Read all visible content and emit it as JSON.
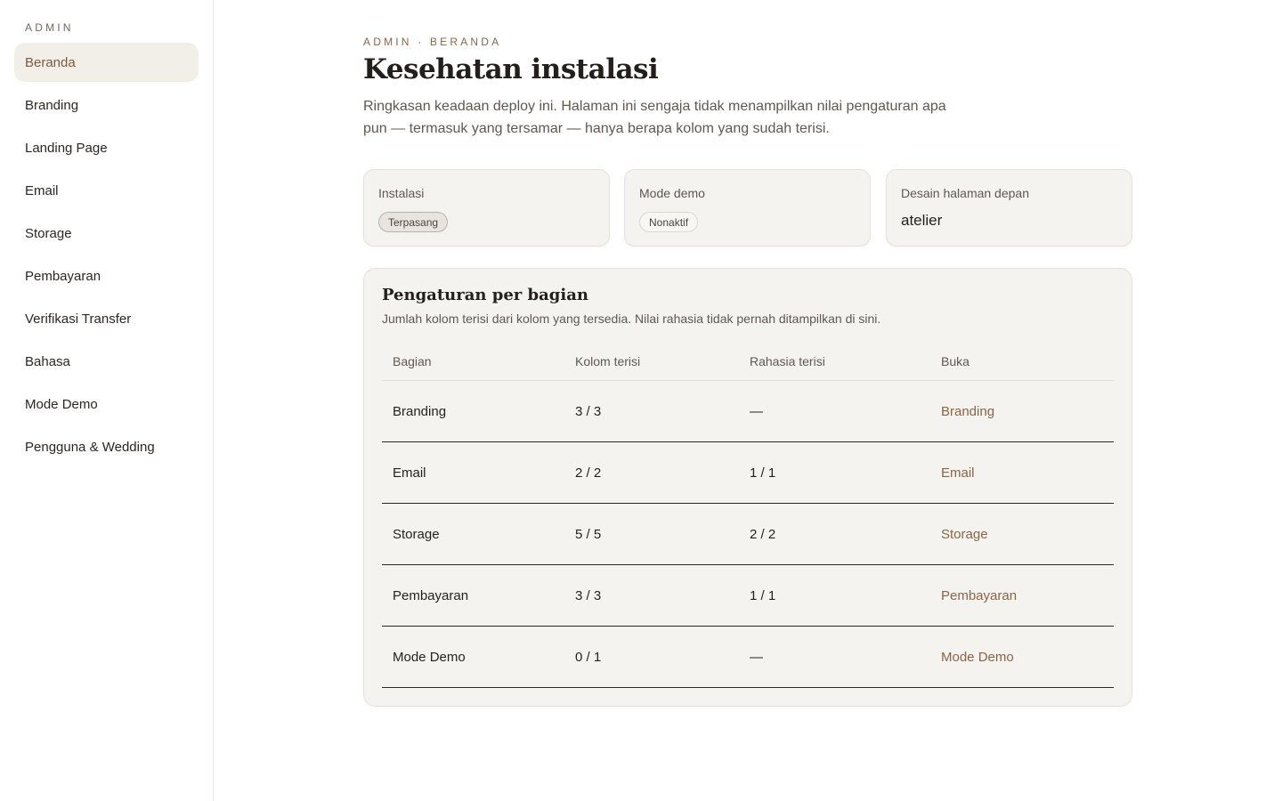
{
  "sidebar": {
    "heading": "ADMIN",
    "items": [
      {
        "label": "Beranda",
        "active": true
      },
      {
        "label": "Branding"
      },
      {
        "label": "Landing Page"
      },
      {
        "label": "Email"
      },
      {
        "label": "Storage"
      },
      {
        "label": "Pembayaran"
      },
      {
        "label": "Verifikasi Transfer"
      },
      {
        "label": "Bahasa"
      },
      {
        "label": "Mode Demo"
      },
      {
        "label": "Pengguna & Wedding"
      }
    ]
  },
  "header": {
    "eyebrow": "ADMIN · BERANDA",
    "title": "Kesehatan instalasi",
    "description": "Ringkasan keadaan deploy ini. Halaman ini sengaja tidak menampilkan nilai pengaturan apa pun — termasuk yang tersamar — hanya berapa kolom yang sudah terisi."
  },
  "cards": {
    "install": {
      "label": "Instalasi",
      "badge": "Terpasang"
    },
    "demo": {
      "label": "Mode demo",
      "badge": "Nonaktif"
    },
    "design": {
      "label": "Desain halaman depan",
      "value": "atelier"
    }
  },
  "sections": {
    "title": "Pengaturan per bagian",
    "description": "Jumlah kolom terisi dari kolom yang tersedia. Nilai rahasia tidak pernah ditampilkan di sini.",
    "columns": [
      "Bagian",
      "Kolom terisi",
      "Rahasia terisi",
      "Buka"
    ],
    "rows": [
      {
        "section": "Branding",
        "fields": "3 / 3",
        "secrets": "—",
        "link": "Branding"
      },
      {
        "section": "Email",
        "fields": "2 / 2",
        "secrets": "1 / 1",
        "link": "Email"
      },
      {
        "section": "Storage",
        "fields": "5 / 5",
        "secrets": "2 / 2",
        "link": "Storage"
      },
      {
        "section": "Pembayaran",
        "fields": "3 / 3",
        "secrets": "1 / 1",
        "link": "Pembayaran"
      },
      {
        "section": "Mode Demo",
        "fields": "0 / 1",
        "secrets": "—",
        "link": "Mode Demo"
      }
    ]
  },
  "colors": {
    "accent": "#8a6446",
    "active_bg": "#f2eee8",
    "card_bg": "#f5f3ef"
  }
}
